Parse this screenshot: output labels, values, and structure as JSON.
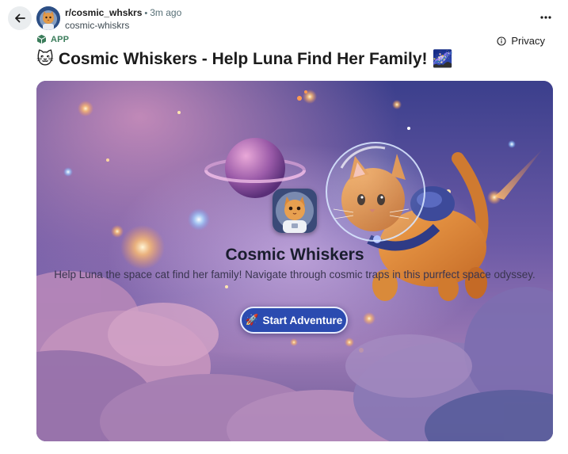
{
  "post": {
    "community": "r/cosmic_whskrs",
    "separator": "•",
    "time_ago": "3m ago",
    "username": "cosmic-whiskrs",
    "app_tag": "APP",
    "privacy_label": "Privacy",
    "title": "Cosmic Whiskers - Help Luna Find Her Family!",
    "title_emoji_left": "🐱",
    "title_emoji_right": "🌌"
  },
  "game": {
    "title": "Cosmic Whiskers",
    "description": "Help Luna the space cat find her family! Navigate through cosmic traps in this purrfect space odyssey.",
    "start_label": "Start Adventure",
    "start_emoji": "🚀"
  },
  "icons": {
    "back": "back-arrow-icon",
    "more": "more-horizontal-icon",
    "privacy": "info-circle-icon",
    "app": "app-cube-icon"
  },
  "colors": {
    "app_tag": "#3b7d5b",
    "button": "#2b4bb0",
    "card_sky_top": "#3a3f86",
    "card_clouds": "#8a6aa8"
  }
}
